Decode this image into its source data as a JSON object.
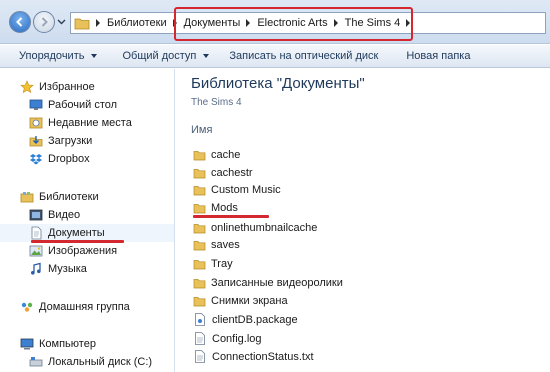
{
  "address_bar": {
    "crumbs": [
      "Библиотеки",
      "Документы",
      "Electronic Arts",
      "The Sims 4"
    ]
  },
  "toolbar": {
    "organize": "Упорядочить",
    "share": "Общий доступ",
    "burn": "Записать на оптический диск",
    "new_folder": "Новая папка"
  },
  "nav": {
    "favorites": {
      "label": "Избранное",
      "items": [
        "Рабочий стол",
        "Недавние места",
        "Загрузки",
        "Dropbox"
      ]
    },
    "libraries": {
      "label": "Библиотеки",
      "items": [
        "Видео",
        "Документы",
        "Изображения",
        "Музыка"
      ]
    },
    "homegroup": "Домашняя группа",
    "computer": {
      "label": "Компьютер",
      "items": [
        "Локальный диск (C:)"
      ]
    }
  },
  "content": {
    "title": "Библиотека \"Документы\"",
    "subtitle": "The Sims 4",
    "column_name": "Имя",
    "folders": [
      "cache",
      "cachestr",
      "Custom Music",
      "Mods",
      "onlinethumbnailcache",
      "saves",
      "Tray",
      "Записанные видеоролики",
      "Снимки экрана"
    ],
    "files": [
      "clientDB.package",
      "Config.log",
      "ConnectionStatus.txt"
    ]
  },
  "colors": {
    "highlight": "#d42830",
    "folder": "#e8c15a",
    "link": "#1e395b"
  }
}
